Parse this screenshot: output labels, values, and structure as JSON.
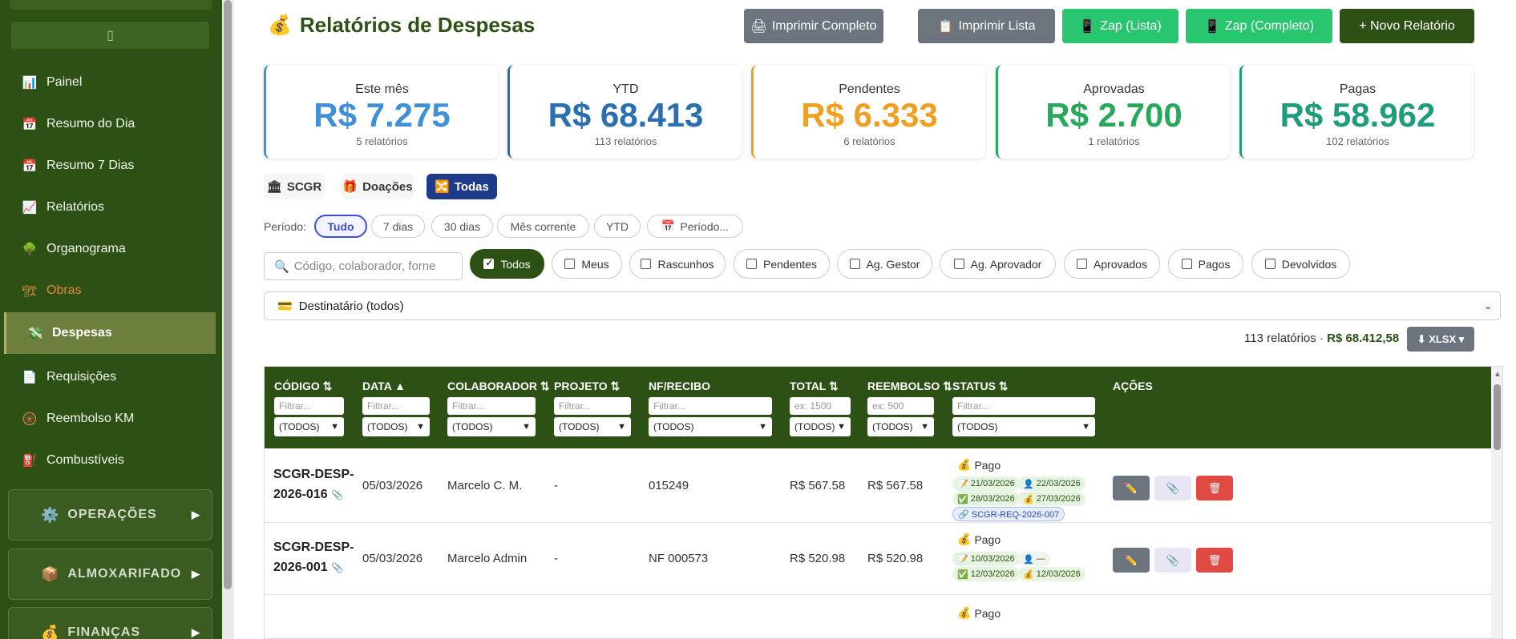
{
  "sidebar": {
    "toggle_icon": "▯",
    "items": [
      {
        "icon": "📊",
        "label": "Painel"
      },
      {
        "icon": "📅",
        "label": "Resumo do Dia"
      },
      {
        "icon": "📅",
        "label": "Resumo 7 Dias"
      },
      {
        "icon": "📈",
        "label": "Relatórios"
      },
      {
        "icon": "🌳",
        "label": "Organograma"
      },
      {
        "icon": "🏗",
        "label": "Obras"
      },
      {
        "icon": "💸",
        "label": "Despesas"
      },
      {
        "icon": "📄",
        "label": "Requisições"
      },
      {
        "icon": "🛞",
        "label": "Reembolso KM"
      },
      {
        "icon": "⛽",
        "label": "Combustíveis"
      }
    ],
    "sections": [
      {
        "icon": "⚙️",
        "label": "OPERAÇÕES",
        "arrow": "▶"
      },
      {
        "icon": "📦",
        "label": "ALMOXARIFADO",
        "arrow": "▶"
      },
      {
        "icon": "💰",
        "label": "FINANÇAS",
        "arrow": "▶"
      }
    ]
  },
  "header": {
    "icon": "💰",
    "title": "Relatórios de Despesas",
    "buttons": [
      {
        "icon": "🖨",
        "label": "Imprimir Completo"
      },
      {
        "icon": "📋",
        "label": "Imprimir Lista"
      },
      {
        "icon": "📱",
        "label": "Zap (Lista)"
      },
      {
        "icon": "📱",
        "label": "Zap (Completo)"
      },
      {
        "icon": "",
        "label": "+ Novo Relatório"
      }
    ]
  },
  "stats": [
    {
      "label": "Este mês",
      "value": "R$ 7.275",
      "sub": "5 relatórios",
      "color": "#3f8fd9"
    },
    {
      "label": "YTD",
      "value": "R$ 68.413",
      "sub": "113 relatórios",
      "color": "#2a6fb0"
    },
    {
      "label": "Pendentes",
      "value": "R$ 6.333",
      "sub": "6 relatórios",
      "color": "#f0a020"
    },
    {
      "label": "Aprovadas",
      "value": "R$ 2.700",
      "sub": "1 relatórios",
      "color": "#27a85a"
    },
    {
      "label": "Pagas",
      "value": "R$ 58.962",
      "sub": "102 relatórios",
      "color": "#1f9c7c"
    }
  ],
  "tabs": [
    {
      "icon": "🏛",
      "label": "SCGR"
    },
    {
      "icon": "🎁",
      "label": "Doações"
    },
    {
      "icon": "🔀",
      "label": "Todas"
    }
  ],
  "period": {
    "label": "Período:",
    "chips": [
      "Tudo",
      "7 dias",
      "30 dias",
      "Mês corrente",
      "YTD",
      "Período..."
    ],
    "custom_icon": "📅"
  },
  "search": {
    "icon": "🔍",
    "placeholder": "Código, colaborador, forne"
  },
  "filters": [
    "Todos",
    "Meus",
    "Rascunhos",
    "Pendentes",
    "Ag. Gestor",
    "Ag. Aprovador",
    "Aprovados",
    "Pagos",
    "Devolvidos"
  ],
  "destinatario": {
    "icon": "💳",
    "label": "Destinatário (todos)",
    "caret": "⌄"
  },
  "summary": {
    "count": "113 relatórios · ",
    "total": "R$ 68.412,58"
  },
  "export": {
    "label": "⬇ XLSX ▾"
  },
  "table": {
    "columns": [
      {
        "label": "CÓDIGO ⇅",
        "filter": "Filtrar...",
        "select": "(TODOS)"
      },
      {
        "label": "DATA ▲",
        "filter": "Filtrar...",
        "select": "(TODOS)"
      },
      {
        "label": "COLABORADOR ⇅",
        "filter": "Filtrar...",
        "select": "(TODOS)"
      },
      {
        "label": "PROJETO ⇅",
        "filter": "Filtrar...",
        "select": "(TODOS)"
      },
      {
        "label": "NF/RECIBO",
        "filter": "Filtrar...",
        "select": "(TODOS)"
      },
      {
        "label": "TOTAL ⇅",
        "filter": "ex: 1500",
        "select": "(TODOS)"
      },
      {
        "label": "REEMBOLSO ⇅",
        "filter": "ex: 500",
        "select": "(TODOS)"
      },
      {
        "label": "STATUS ⇅",
        "filter": "Filtrar...",
        "select": "(TODOS)"
      },
      {
        "label": "AÇÕES",
        "filter": "",
        "select": ""
      }
    ],
    "rows": [
      {
        "code_line1": "SCGR-DESP-",
        "code_line2": "2026-016",
        "clip": "📎",
        "date": "05/03/2026",
        "colaborador": "Marcelo C. M.",
        "projeto": "-",
        "nf": "015249",
        "total": "R$ 567.58",
        "reembolso": "R$ 567.58",
        "status": "Pago",
        "status_icon": "💰",
        "badges": [
          {
            "icon": "📝",
            "date": "21/03/2026"
          },
          {
            "icon": "👤",
            "date": "22/03/2026"
          },
          {
            "icon": "✅",
            "date": "28/03/2026"
          },
          {
            "icon": "💰",
            "date": "27/03/2026"
          }
        ],
        "req": "🔗 SCGR-REQ-2026-007"
      },
      {
        "code_line1": "SCGR-DESP-",
        "code_line2": "2026-001",
        "clip": "📎",
        "date": "05/03/2026",
        "colaborador": "Marcelo Admin",
        "projeto": "-",
        "nf": "NF 000573",
        "total": "R$ 520.98",
        "reembolso": "R$ 520.98",
        "status": "Pago",
        "status_icon": "💰",
        "badges": [
          {
            "icon": "📝",
            "date": "10/03/2026"
          },
          {
            "icon": "👤",
            "date": "—"
          },
          {
            "icon": "✅",
            "date": "12/03/2026"
          },
          {
            "icon": "💰",
            "date": "12/03/2026"
          }
        ],
        "req": ""
      },
      {
        "status": "Pago",
        "status_icon": "💰"
      }
    ],
    "actions": {
      "edit": "✏️",
      "attach": "📎",
      "delete": "🗑"
    }
  }
}
